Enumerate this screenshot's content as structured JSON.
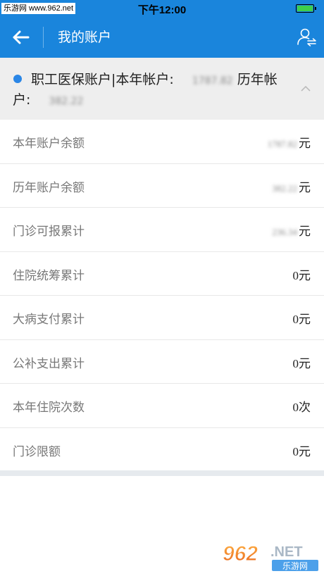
{
  "status_bar": {
    "watermark": "乐游网 www.962.net",
    "time": "下午12:00"
  },
  "nav": {
    "title": "我的账户"
  },
  "account_header": {
    "title": "职工医保账户|本年帐户:",
    "current_year_value": "1787.82",
    "history_label": "历年帐户:",
    "history_value": "382.22"
  },
  "rows": [
    {
      "label": "本年账户余额",
      "value_blurred": "1787.82",
      "unit": "元"
    },
    {
      "label": "历年账户余额",
      "value_blurred": "382.22",
      "unit": "元"
    },
    {
      "label": "门诊可报累计",
      "value_blurred": "236.34",
      "unit": "元"
    },
    {
      "label": "住院统筹累计",
      "value": "0元"
    },
    {
      "label": "大病支付累计",
      "value": "0元"
    },
    {
      "label": "公补支出累计",
      "value": "0元"
    },
    {
      "label": "本年住院次数",
      "value": "0次"
    },
    {
      "label": "门诊限额",
      "value": "0元"
    }
  ],
  "watermark_bottom": {
    "number": "962",
    "net": ".NET",
    "cn": "乐游网"
  },
  "colors": {
    "primary": "#1a85dc",
    "header_bg": "#eeeeee",
    "dot": "#2a86e6"
  }
}
